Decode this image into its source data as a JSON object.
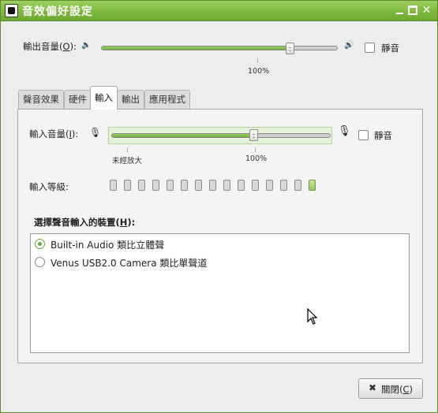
{
  "window": {
    "title": "音效偏好設定"
  },
  "output": {
    "label_pre": "輸出音量(",
    "label_key": "O",
    "label_post": "):",
    "percent_label": "100%",
    "volume_fraction": 0.8,
    "mute_label": "靜音",
    "mute_checked": false
  },
  "tabs": [
    {
      "label": "聲音效果",
      "active": false
    },
    {
      "label": "硬件",
      "active": false
    },
    {
      "label": "輸入",
      "active": true
    },
    {
      "label": "輸出",
      "active": false
    },
    {
      "label": "應用程式",
      "active": false
    }
  ],
  "input": {
    "label_pre": "輸入音量(",
    "label_key": "I",
    "label_post": "):",
    "unamplified_label": "未經放大",
    "percent_label": "100%",
    "volume_fraction": 0.65,
    "mute_label": "靜音",
    "mute_checked": false,
    "level_label": "輸入等級:",
    "level_blocks_total": 15,
    "level_blocks_lit_last": true
  },
  "devices": {
    "heading_pre": "選擇聲音輸入的裝置(",
    "heading_key": "H",
    "heading_post": "):",
    "items": [
      {
        "label": "Built-in Audio 類比立體聲",
        "selected": true
      },
      {
        "label": "Venus USB2.0 Camera 類比單聲道",
        "selected": false
      }
    ]
  },
  "buttons": {
    "close_pre": "關閉(",
    "close_key": "C",
    "close_post": ")"
  },
  "colors": {
    "accent": "#7fb83f",
    "level_on": "#9ac86a"
  }
}
